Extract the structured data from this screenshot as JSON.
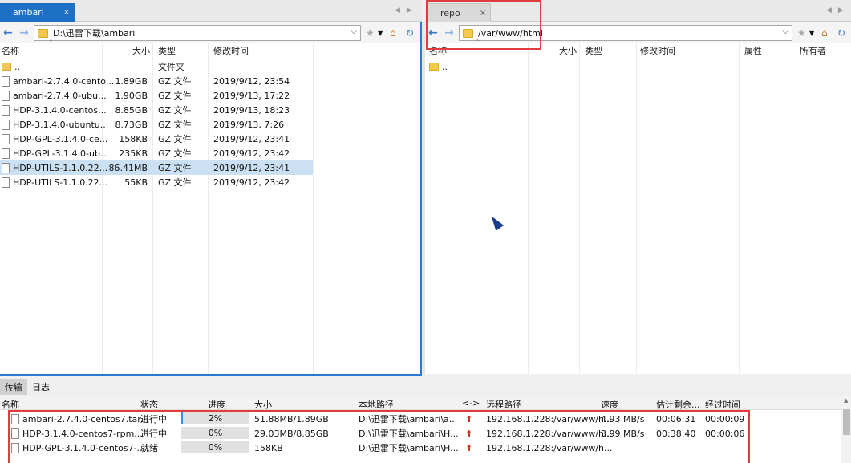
{
  "left": {
    "tab_label": "ambari",
    "tab_close": "×",
    "path": "D:\\迅雷下载\\ambari",
    "columns": [
      "名称",
      "大小",
      "类型",
      "修改时间"
    ],
    "updir": {
      "name": "..",
      "type": "文件夹"
    },
    "files": [
      {
        "name": "ambari-2.7.4.0-cento...",
        "size": "1.89GB",
        "type": "GZ 文件",
        "modified": "2019/9/12, 23:54"
      },
      {
        "name": "ambari-2.7.4.0-ubu...",
        "size": "1.90GB",
        "type": "GZ 文件",
        "modified": "2019/9/13, 17:22"
      },
      {
        "name": "HDP-3.1.4.0-centos...",
        "size": "8.85GB",
        "type": "GZ 文件",
        "modified": "2019/9/13, 18:23"
      },
      {
        "name": "HDP-3.1.4.0-ubuntu...",
        "size": "8.73GB",
        "type": "GZ 文件",
        "modified": "2019/9/13, 7:26"
      },
      {
        "name": "HDP-GPL-3.1.4.0-ce...",
        "size": "158KB",
        "type": "GZ 文件",
        "modified": "2019/9/12, 23:41"
      },
      {
        "name": "HDP-GPL-3.1.4.0-ub...",
        "size": "235KB",
        "type": "GZ 文件",
        "modified": "2019/9/12, 23:42"
      },
      {
        "name": "HDP-UTILS-1.1.0.22...",
        "size": "86.41MB",
        "type": "GZ 文件",
        "modified": "2019/9/12, 23:41",
        "selected": true
      },
      {
        "name": "HDP-UTILS-1.1.0.22...",
        "size": "55KB",
        "type": "GZ 文件",
        "modified": "2019/9/12, 23:42"
      }
    ]
  },
  "right": {
    "tab_label": "repo",
    "tab_close": "×",
    "path": "/var/www/html",
    "columns": [
      "名称",
      "大小",
      "类型",
      "修改时间",
      "属性",
      "所有者"
    ],
    "updir": {
      "name": ".."
    }
  },
  "transfer": {
    "tabs": [
      "传输",
      "日志"
    ],
    "columns": [
      "名称",
      "状态",
      "进度",
      "大小",
      "本地路径",
      "<->",
      "远程路径",
      "速度",
      "估计剩余...",
      "经过时间"
    ],
    "rows": [
      {
        "name": "ambari-2.7.4.0-centos7.tar...",
        "status": "进行中",
        "progress": "2%",
        "progress_value": 0.02,
        "size": "51.88MB/1.89GB",
        "local": "D:\\迅雷下载\\ambari\\a...",
        "remote": "192.168.1.228:/var/www/h...",
        "speed": "4.93 MB/s",
        "remaining": "00:06:31",
        "elapsed": "00:00:09"
      },
      {
        "name": "HDP-3.1.4.0-centos7-rpm....",
        "status": "进行中",
        "progress": "0%",
        "progress_value": 0.0,
        "size": "29.03MB/8.85GB",
        "local": "D:\\迅雷下载\\ambari\\H...",
        "remote": "192.168.1.228:/var/www/h...",
        "speed": "3.99 MB/s",
        "remaining": "00:38:40",
        "elapsed": "00:00:06"
      },
      {
        "name": "HDP-GPL-3.1.4.0-centos7-...",
        "status": "就绪",
        "progress": "0%",
        "progress_value": 0.0,
        "size": "158KB",
        "local": "D:\\迅雷下载\\ambari\\H...",
        "remote": "192.168.1.228:/var/www/h...",
        "speed": "",
        "remaining": "",
        "elapsed": ""
      }
    ]
  },
  "icons": {
    "back": "arrow-left-icon",
    "forward": "arrow-right-icon",
    "bookmark": "star-icon",
    "home": "home-icon",
    "refresh": "refresh-icon",
    "upload": "arrow-up-icon"
  },
  "colors": {
    "accent": "#1e6fc6",
    "selection": "#cce0f4",
    "highlight": "#e23c3c",
    "connected_dot": "#1f8a3a"
  }
}
